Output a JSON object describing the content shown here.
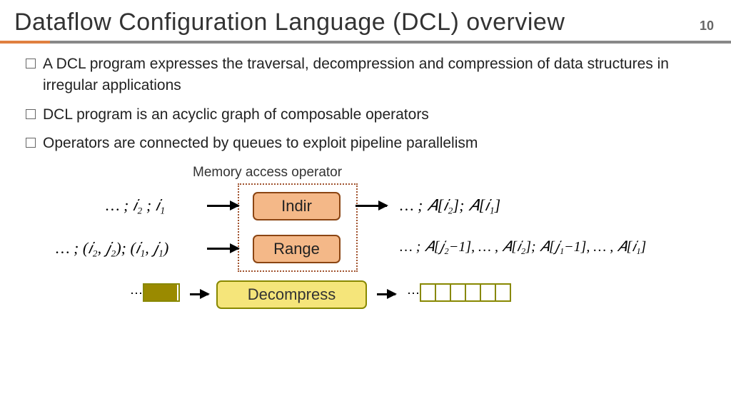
{
  "title": "Dataflow Configuration Language (DCL) overview",
  "page_number": "10",
  "bullets": [
    "A DCL program expresses the traversal, decompression and compression of data structures in irregular applications",
    "DCL program is an acyclic graph of composable operators",
    "Operators are connected by queues to exploit pipeline parallelism"
  ],
  "diagram": {
    "memory_label": "Memory access operator",
    "op_indir": "Indir",
    "op_range": "Range",
    "op_decompress": "Decompress",
    "indir_in": "… ; 𝑖₂ ; 𝑖₁",
    "indir_out": "… ; 𝐴[𝑖₂]; 𝐴[𝑖₁]",
    "range_in": "… ; (𝑖₂, 𝑗₂); (𝑖₁, 𝑗₁)",
    "range_out": "… ; 𝐴[𝑗₂−1], … , 𝐴[𝑖₂]; 𝐴[𝑗₁−1], … , 𝐴[𝑖₁]"
  }
}
